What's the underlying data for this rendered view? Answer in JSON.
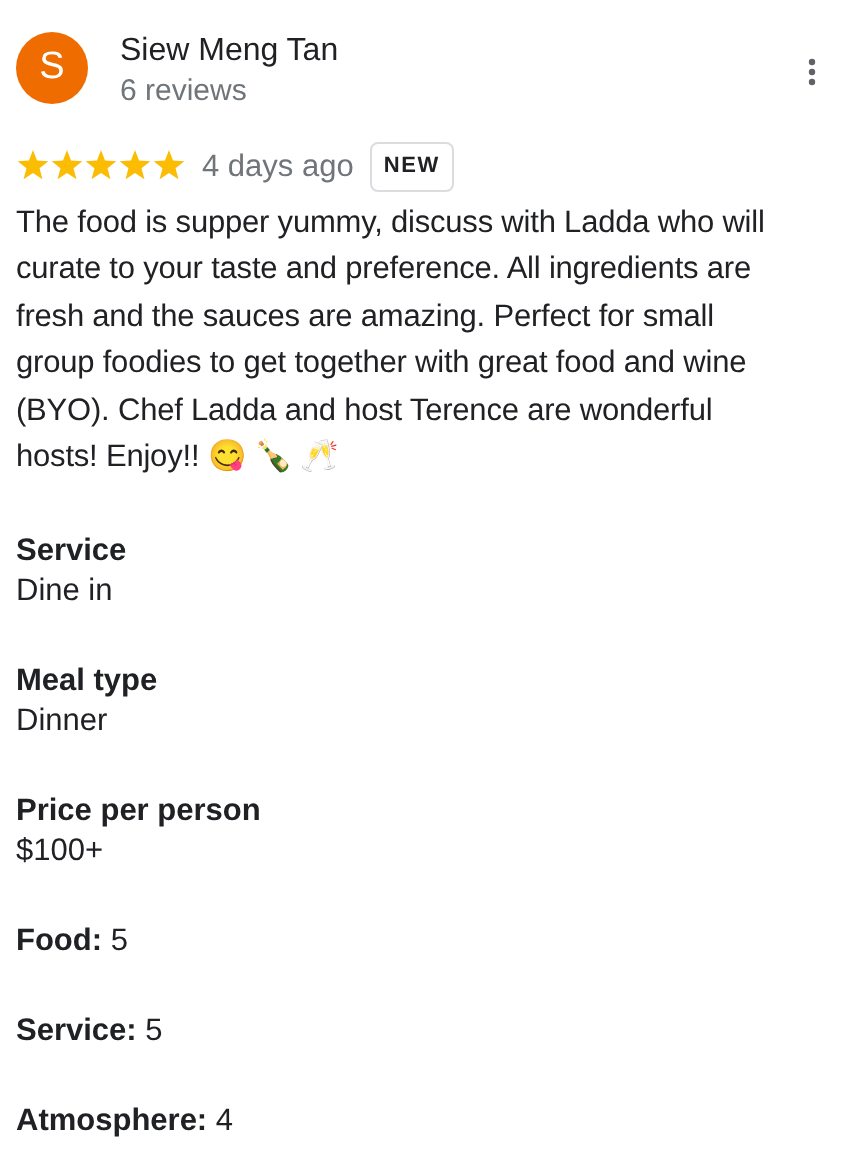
{
  "reviewer": {
    "initial": "S",
    "name": "Siew Meng Tan",
    "reviews": "6 reviews"
  },
  "rating": {
    "stars": 5,
    "time": "4 days ago",
    "badge": "NEW"
  },
  "text": "The food is supper yummy, discuss with Ladda who will curate to your taste and preference. All ingredients are fresh and the sauces are amazing. Perfect for small group foodies to get together with great food and wine (BYO). Chef Ladda and host Terence are wonderful hosts! Enjoy!! 😋 🍾 🥂",
  "attributes": [
    {
      "kind": "stacked",
      "label": "Service",
      "value": "Dine in"
    },
    {
      "kind": "stacked",
      "label": "Meal type",
      "value": "Dinner"
    },
    {
      "kind": "stacked",
      "label": "Price per person",
      "value": "$100+"
    },
    {
      "kind": "inline",
      "label": "Food:",
      "value": "5"
    },
    {
      "kind": "inline",
      "label": "Service:",
      "value": "5"
    },
    {
      "kind": "inline",
      "label": "Atmosphere:",
      "value": "4"
    }
  ]
}
